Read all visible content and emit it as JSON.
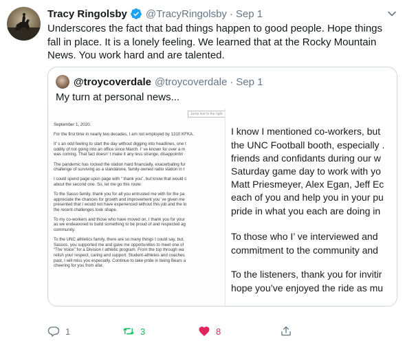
{
  "tweet": {
    "author_name": "Tracy Ringolsby",
    "handle": "@TracyRingolsby",
    "separator": "·",
    "date": "Sep 1",
    "body": "Underscores the fact that bad things happen to good people. Hope things fall in place. It is a lonely feeling. We learned that at the Rocky Mountain News. You work hard and are talented.",
    "verified_icon": "verified-badge-icon",
    "colors": {
      "accent": "#1da1f2",
      "retweet": "#17bf63",
      "like": "#e0245e",
      "muted": "#657786"
    }
  },
  "quote": {
    "author_name": "@troycoverdale",
    "handle": "@troycoverdale",
    "separator": "·",
    "date": "Sep 1",
    "text": "My turn at personal news...",
    "document": {
      "note": "Jump text to the right",
      "paragraphs": [
        [
          "September 1, 2020."
        ],
        [
          "For the first time in nearly two decades, I am not employed by 1310 KFKA."
        ],
        [
          "It’ s an odd feeling to start the day without digging into headlines, one t",
          "oddity of not going into an office since March.  I’ ve known for over a m",
          "was coming. That fact doesn’ t make it any less strange, disappointin"
        ],
        [
          "The pandemic has rocked the station hard financially, exacerbating fur",
          "challenge of surviving as a standalone, family-owned radio station in t"
        ],
        [
          "I could spend page upon page with “ thank you”, but know that would c",
          "about the second one. So, let me go this route:"
        ],
        [
          "To the Sasso family, thank you for all you entrusted me with for the pa",
          "appreciate the chances for growth and improvement you’ ve given me",
          "presented that I would not have experienced without this job and the lo",
          "the recent challenges took shape."
        ],
        [
          "To my co-workers and those who have moved on, I thank you for your",
          "as we endeavored to build something to be proud of and respected ag",
          "community."
        ],
        [
          "To the UNC athletics family, there are so many things I could say, but,",
          "Sassos, you supported me and gave me opportunities to meet one of",
          "“The Voice” for a Division I athletic program. From the top through wa",
          "relish your respect, caring and support. Student-athletes and coaches",
          "past, I will miss you especially. Continue to take pride in being Bears a",
          "cheering for you from afar."
        ]
      ],
      "big_lines": [
        "I know I mentioned co-workers, but",
        "the UNC Football booth, especially .",
        "friends and confidants during our w",
        "Saturday game day to work with yo",
        "Matt Priesmeyer, Alex Egan, Jeff Ec",
        "each of you and help you in your pu",
        "pride in what you each are doing in",
        "To those who I’ ve interviewed and",
        "commitment to the community and",
        "To the listeners, thank you for invitir",
        "hope you’ve enjoyed the ride as mu"
      ]
    }
  },
  "actions": {
    "reply": {
      "icon": "reply-icon",
      "count": "1"
    },
    "retweet": {
      "icon": "retweet-icon",
      "count": "3"
    },
    "like": {
      "icon": "heart-icon",
      "count": "8"
    },
    "share": {
      "icon": "share-icon"
    }
  },
  "menu_icon": "chevron-down-icon"
}
